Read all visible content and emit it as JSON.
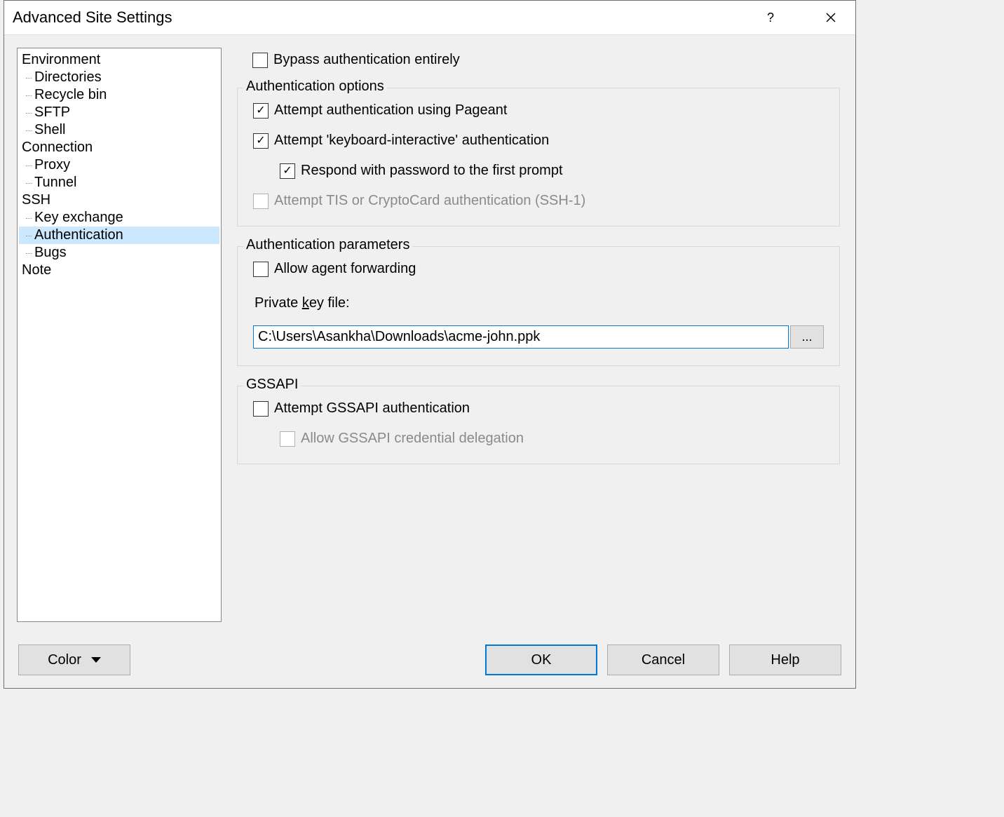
{
  "title": "Advanced Site Settings",
  "tree": [
    {
      "label": "Environment",
      "level": 0
    },
    {
      "label": "Directories",
      "level": 1
    },
    {
      "label": "Recycle bin",
      "level": 1
    },
    {
      "label": "SFTP",
      "level": 1
    },
    {
      "label": "Shell",
      "level": 1
    },
    {
      "label": "Connection",
      "level": 0
    },
    {
      "label": "Proxy",
      "level": 1
    },
    {
      "label": "Tunnel",
      "level": 1
    },
    {
      "label": "SSH",
      "level": 0
    },
    {
      "label": "Key exchange",
      "level": 1
    },
    {
      "label": "Authentication",
      "level": 1,
      "selected": true
    },
    {
      "label": "Bugs",
      "level": 1
    },
    {
      "label": "Note",
      "level": 0
    }
  ],
  "bypass": {
    "label": "Bypass authentication entirely",
    "checked": false
  },
  "group_options": {
    "title": "Authentication options",
    "pageant": {
      "label": "Attempt authentication using Pageant",
      "checked": true
    },
    "kbdint": {
      "label": "Attempt 'keyboard-interactive' authentication",
      "checked": true
    },
    "respond_pw": {
      "label": "Respond with password to the first prompt",
      "checked": true
    },
    "tis": {
      "label": "Attempt TIS or CryptoCard authentication (SSH-1)",
      "checked": false,
      "disabled": true
    }
  },
  "group_params": {
    "title": "Authentication parameters",
    "agent_fwd": {
      "label": "Allow agent forwarding",
      "checked": false
    },
    "keyfile_label_pre": "Private ",
    "keyfile_label_accel": "k",
    "keyfile_label_post": "ey file:",
    "keyfile_value": "C:\\Users\\Asankha\\Downloads\\acme-john.ppk",
    "browse_label": "..."
  },
  "group_gssapi": {
    "title": "GSSAPI",
    "attempt": {
      "label": "Attempt GSSAPI authentication",
      "checked": false
    },
    "delegate": {
      "label": "Allow GSSAPI credential delegation",
      "checked": false,
      "disabled": true
    }
  },
  "footer": {
    "color": "Color",
    "ok": "OK",
    "cancel": "Cancel",
    "help": "Help"
  }
}
